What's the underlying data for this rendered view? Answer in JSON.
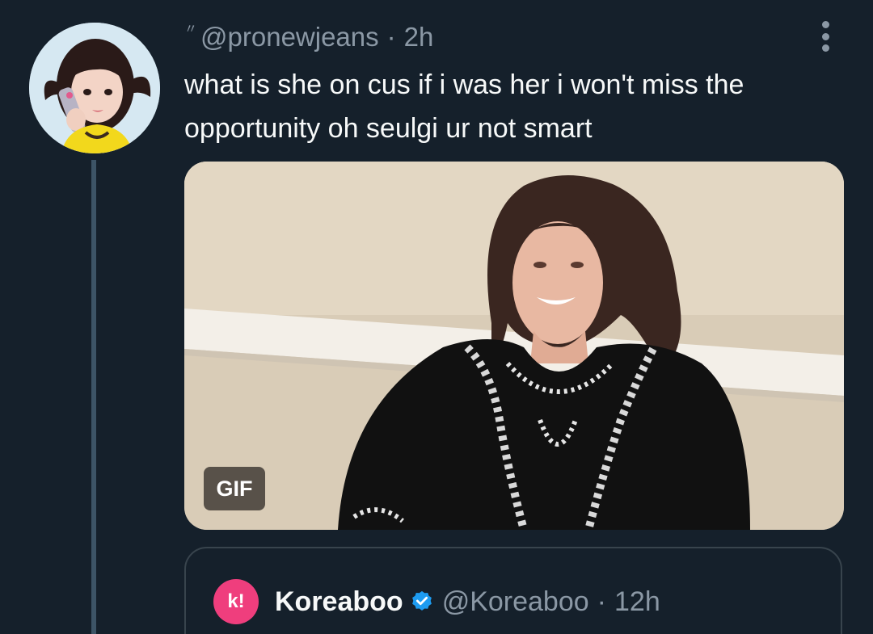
{
  "tweet": {
    "handle": "@pronewjeans",
    "separator": "·",
    "time": "2h",
    "text": "what is she on cus if i was her i won't miss the opportunity oh seulgi ur not smart",
    "media": {
      "badge": "GIF"
    }
  },
  "quoted": {
    "avatar_text": "k!",
    "name": "Koreaboo",
    "handle": "@Koreaboo",
    "separator": "·",
    "time": "12h"
  },
  "colors": {
    "background": "#15202b",
    "text": "#f7f9f9",
    "secondary_text": "#8b98a5",
    "verified": "#1d9bf0",
    "koreaboo_brand": "#ef3e7d",
    "thread_line": "#3d5466"
  }
}
